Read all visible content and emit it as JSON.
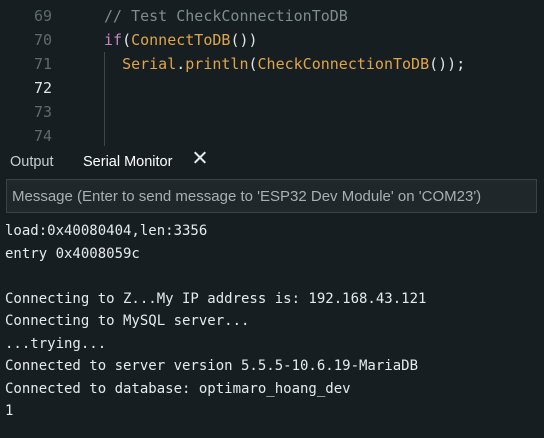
{
  "editor": {
    "lines": [
      {
        "number": "69",
        "parts": [
          {
            "t": "// Test CheckConnectionToDB",
            "c": "tok-comment"
          }
        ]
      },
      {
        "number": "70",
        "parts": [
          {
            "t": "if",
            "c": "tok-kw"
          },
          {
            "t": "(",
            "c": "tok-punc"
          },
          {
            "t": "ConnectToDB",
            "c": "tok-fn"
          },
          {
            "t": "())",
            "c": "tok-punc"
          }
        ]
      },
      {
        "number": "71",
        "parts": [
          {
            "t": "  ",
            "c": "tok-punc"
          },
          {
            "t": "Serial",
            "c": "tok-kw2"
          },
          {
            "t": ".",
            "c": "tok-punc"
          },
          {
            "t": "println",
            "c": "tok-fn"
          },
          {
            "t": "(",
            "c": "tok-punc"
          },
          {
            "t": "CheckConnectionToDB",
            "c": "tok-fn"
          },
          {
            "t": "());",
            "c": "tok-punc"
          }
        ]
      },
      {
        "number": "72",
        "parts": []
      },
      {
        "number": "73",
        "parts": []
      },
      {
        "number": "74",
        "parts": []
      }
    ]
  },
  "panel": {
    "tab_output": "Output",
    "tab_serial": "Serial Monitor",
    "close_icon": "close-icon"
  },
  "message": {
    "placeholder": "Message (Enter to send message to 'ESP32 Dev Module' on 'COM23')",
    "value": ""
  },
  "console": {
    "lines": [
      "load:0x40080404,len:3356",
      "entry 0x4008059c",
      "",
      "Connecting to Z...My IP address is: 192.168.43.121",
      "Connecting to MySQL server...",
      "...trying...",
      "Connected to server version 5.5.5-10.6.19-MariaDB",
      "Connected to database: optimaro_hoang_dev",
      "1"
    ]
  },
  "colors": {
    "background": "#171e21",
    "comment": "#7f8c8d",
    "keyword": "#c586c0",
    "function": "#e0a44a",
    "text": "#dfe4e6"
  }
}
